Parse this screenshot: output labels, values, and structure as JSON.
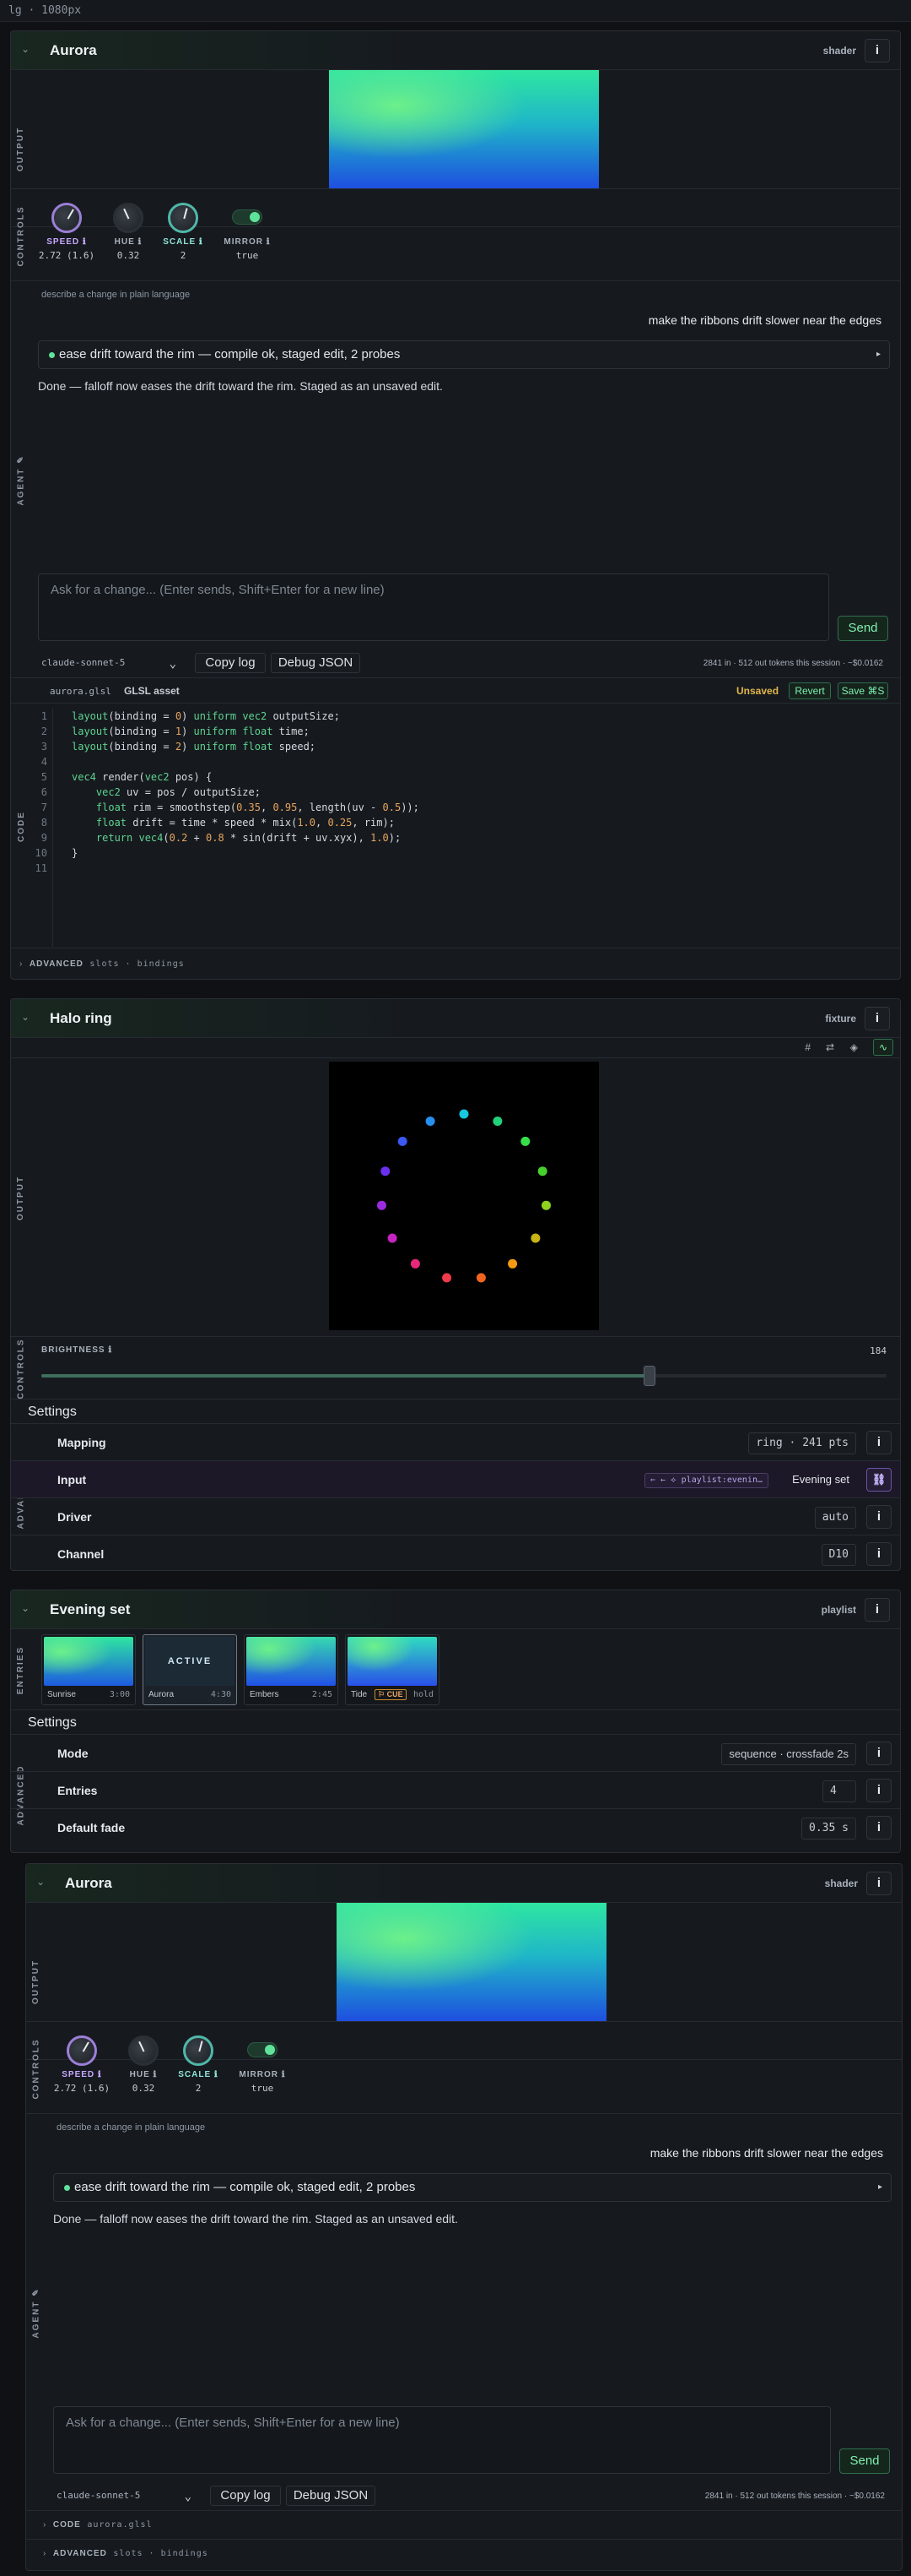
{
  "topbar": {
    "text": "lg · 1080px"
  },
  "aurora": {
    "title": "Aurora",
    "type": "shader",
    "info": "i",
    "section_output": "OUTPUT",
    "section_controls": "CONTROLS",
    "section_agent": "AGENT",
    "section_code": "CODE",
    "section_advanced": "ADVANCED",
    "controls": [
      {
        "label": "SPEED ℹ",
        "value": "2.72 (1.6)",
        "color": "#c9a8ff",
        "level": 0.62
      },
      {
        "label": "HUE ℹ",
        "value": "0.32",
        "color": "#aab2bb",
        "level": 0.32
      },
      {
        "label": "SCALE ℹ",
        "value": "2",
        "color": "#8fe3d6",
        "level": 0.5
      },
      {
        "label": "MIRROR ℹ",
        "value": "true",
        "color": "#aab2bb"
      }
    ],
    "agent": {
      "hint": "describe a change in plain language",
      "user_message": "make the ribbons drift slower near the edges",
      "step": "ease drift toward the rim — compile ok, staged edit, 2 probes",
      "step_toggle": "▸",
      "reply": "Done — falloff now eases the drift toward the rim. Staged as an unsaved edit.",
      "input_placeholder": "Ask for a change... (Enter sends, Shift+Enter for a new line)",
      "send_label": "Send",
      "model": "claude-sonnet-5",
      "model_chevron": "⌄",
      "copy_log": "Copy log",
      "debug_json": "Debug JSON",
      "usage": "2841 in · 512 out tokens this session · ~$0.0162"
    },
    "code": {
      "filename": "aurora.glsl",
      "kind": "GLSL asset",
      "status": "Unsaved",
      "revert": "Revert",
      "save": "Save ⌘S",
      "line_numbers": "1\n2\n3\n4\n5\n6\n7\n8\n9\n10\n11"
    },
    "advanced": {
      "label": "ADVANCED",
      "detail": "slots · bindings",
      "chevron": "›"
    },
    "agent_icon": "✎"
  },
  "halo": {
    "title": "Halo ring",
    "type": "fixture",
    "info": "i",
    "toolbar_icons": [
      "#",
      "⇄",
      "◈",
      "∿"
    ],
    "section_output": "OUTPUT",
    "section_controls": "CONTROLS",
    "section_advanced": "ADVANCED",
    "brightness_label": "BRIGHTNESS ℹ",
    "brightness_value": "184",
    "brightness_level": 0.72,
    "settings_title": "Settings",
    "settings": [
      {
        "label": "Mapping",
        "value": "ring · 241 pts"
      },
      {
        "label": "Input",
        "value": "Evening set",
        "chip": "⇐ ← ⟡ playlist:evenin…",
        "link_icon": "⛓"
      },
      {
        "label": "Driver",
        "value": "auto"
      },
      {
        "label": "Channel",
        "value": "D10"
      }
    ],
    "led_colors": [
      "#18c7e0",
      "#22d27a",
      "#37e04a",
      "#46d02c",
      "#8ed21e",
      "#c8b414",
      "#f59a12",
      "#f2651f",
      "#ef3a4a",
      "#e8287a",
      "#c524c0",
      "#9a2be0",
      "#6a30f0",
      "#3a58f2",
      "#2690f0"
    ]
  },
  "evening": {
    "title": "Evening set",
    "type": "playlist",
    "info": "i",
    "section_entries": "ENTRIES",
    "section_advanced": "ADVANCED",
    "entries": [
      {
        "name": "Sunrise",
        "duration": "3:00"
      },
      {
        "name": "Aurora",
        "duration": "4:30",
        "active": "ACTIVE"
      },
      {
        "name": "Embers",
        "duration": "2:45"
      },
      {
        "name": "Tide",
        "cue": "⚐ CUE",
        "duration": "hold"
      }
    ],
    "settings_title": "Settings",
    "settings": [
      {
        "label": "Mode",
        "value": "sequence · crossfade 2s"
      },
      {
        "label": "Entries",
        "value": "4"
      },
      {
        "label": "Default fade",
        "value": "0.35 s"
      }
    ]
  },
  "aurora2": {
    "title": "Aurora",
    "type": "shader",
    "info": "i",
    "code_label": "CODE",
    "code_file": "aurora.glsl",
    "advanced_label": "ADVANCED",
    "advanced_detail": "slots · bindings"
  }
}
